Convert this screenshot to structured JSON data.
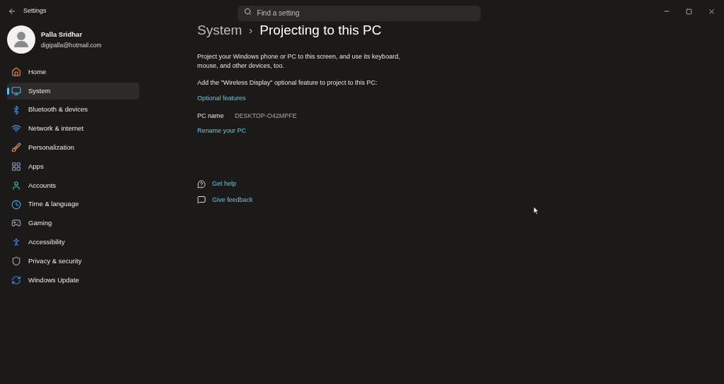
{
  "window": {
    "title": "Settings"
  },
  "search": {
    "placeholder": "Find a setting"
  },
  "account": {
    "name": "Palla Sridhar",
    "email": "digipalla@hotmail.com"
  },
  "sidebar": {
    "items": [
      {
        "label": "Home",
        "kind": "home",
        "selected": false
      },
      {
        "label": "System",
        "kind": "system",
        "selected": true
      },
      {
        "label": "Bluetooth & devices",
        "kind": "bluetooth",
        "selected": false
      },
      {
        "label": "Network & internet",
        "kind": "network",
        "selected": false
      },
      {
        "label": "Personalization",
        "kind": "brush",
        "selected": false
      },
      {
        "label": "Apps",
        "kind": "apps",
        "selected": false
      },
      {
        "label": "Accounts",
        "kind": "accounts",
        "selected": false
      },
      {
        "label": "Time & language",
        "kind": "time",
        "selected": false
      },
      {
        "label": "Gaming",
        "kind": "gaming",
        "selected": false
      },
      {
        "label": "Accessibility",
        "kind": "accessibility",
        "selected": false
      },
      {
        "label": "Privacy & security",
        "kind": "shield",
        "selected": false
      },
      {
        "label": "Windows Update",
        "kind": "update",
        "selected": false
      }
    ]
  },
  "breadcrumb": {
    "parent": "System",
    "separator": "›",
    "current": "Projecting to this PC"
  },
  "content": {
    "description": "Project your Windows phone or PC to this screen, and use its keyboard, mouse, and other devices, too.",
    "feature_note": "Add the \"Wireless Display\" optional feature to project to this PC:",
    "feature_link": "Optional features",
    "pc_name_label": "PC name",
    "pc_name": "DESKTOP-O42MPFE",
    "rename_link": "Rename your PC"
  },
  "help_links": [
    {
      "label": "Get help",
      "kind": "help"
    },
    {
      "label": "Give feedback",
      "kind": "feedback"
    }
  ]
}
